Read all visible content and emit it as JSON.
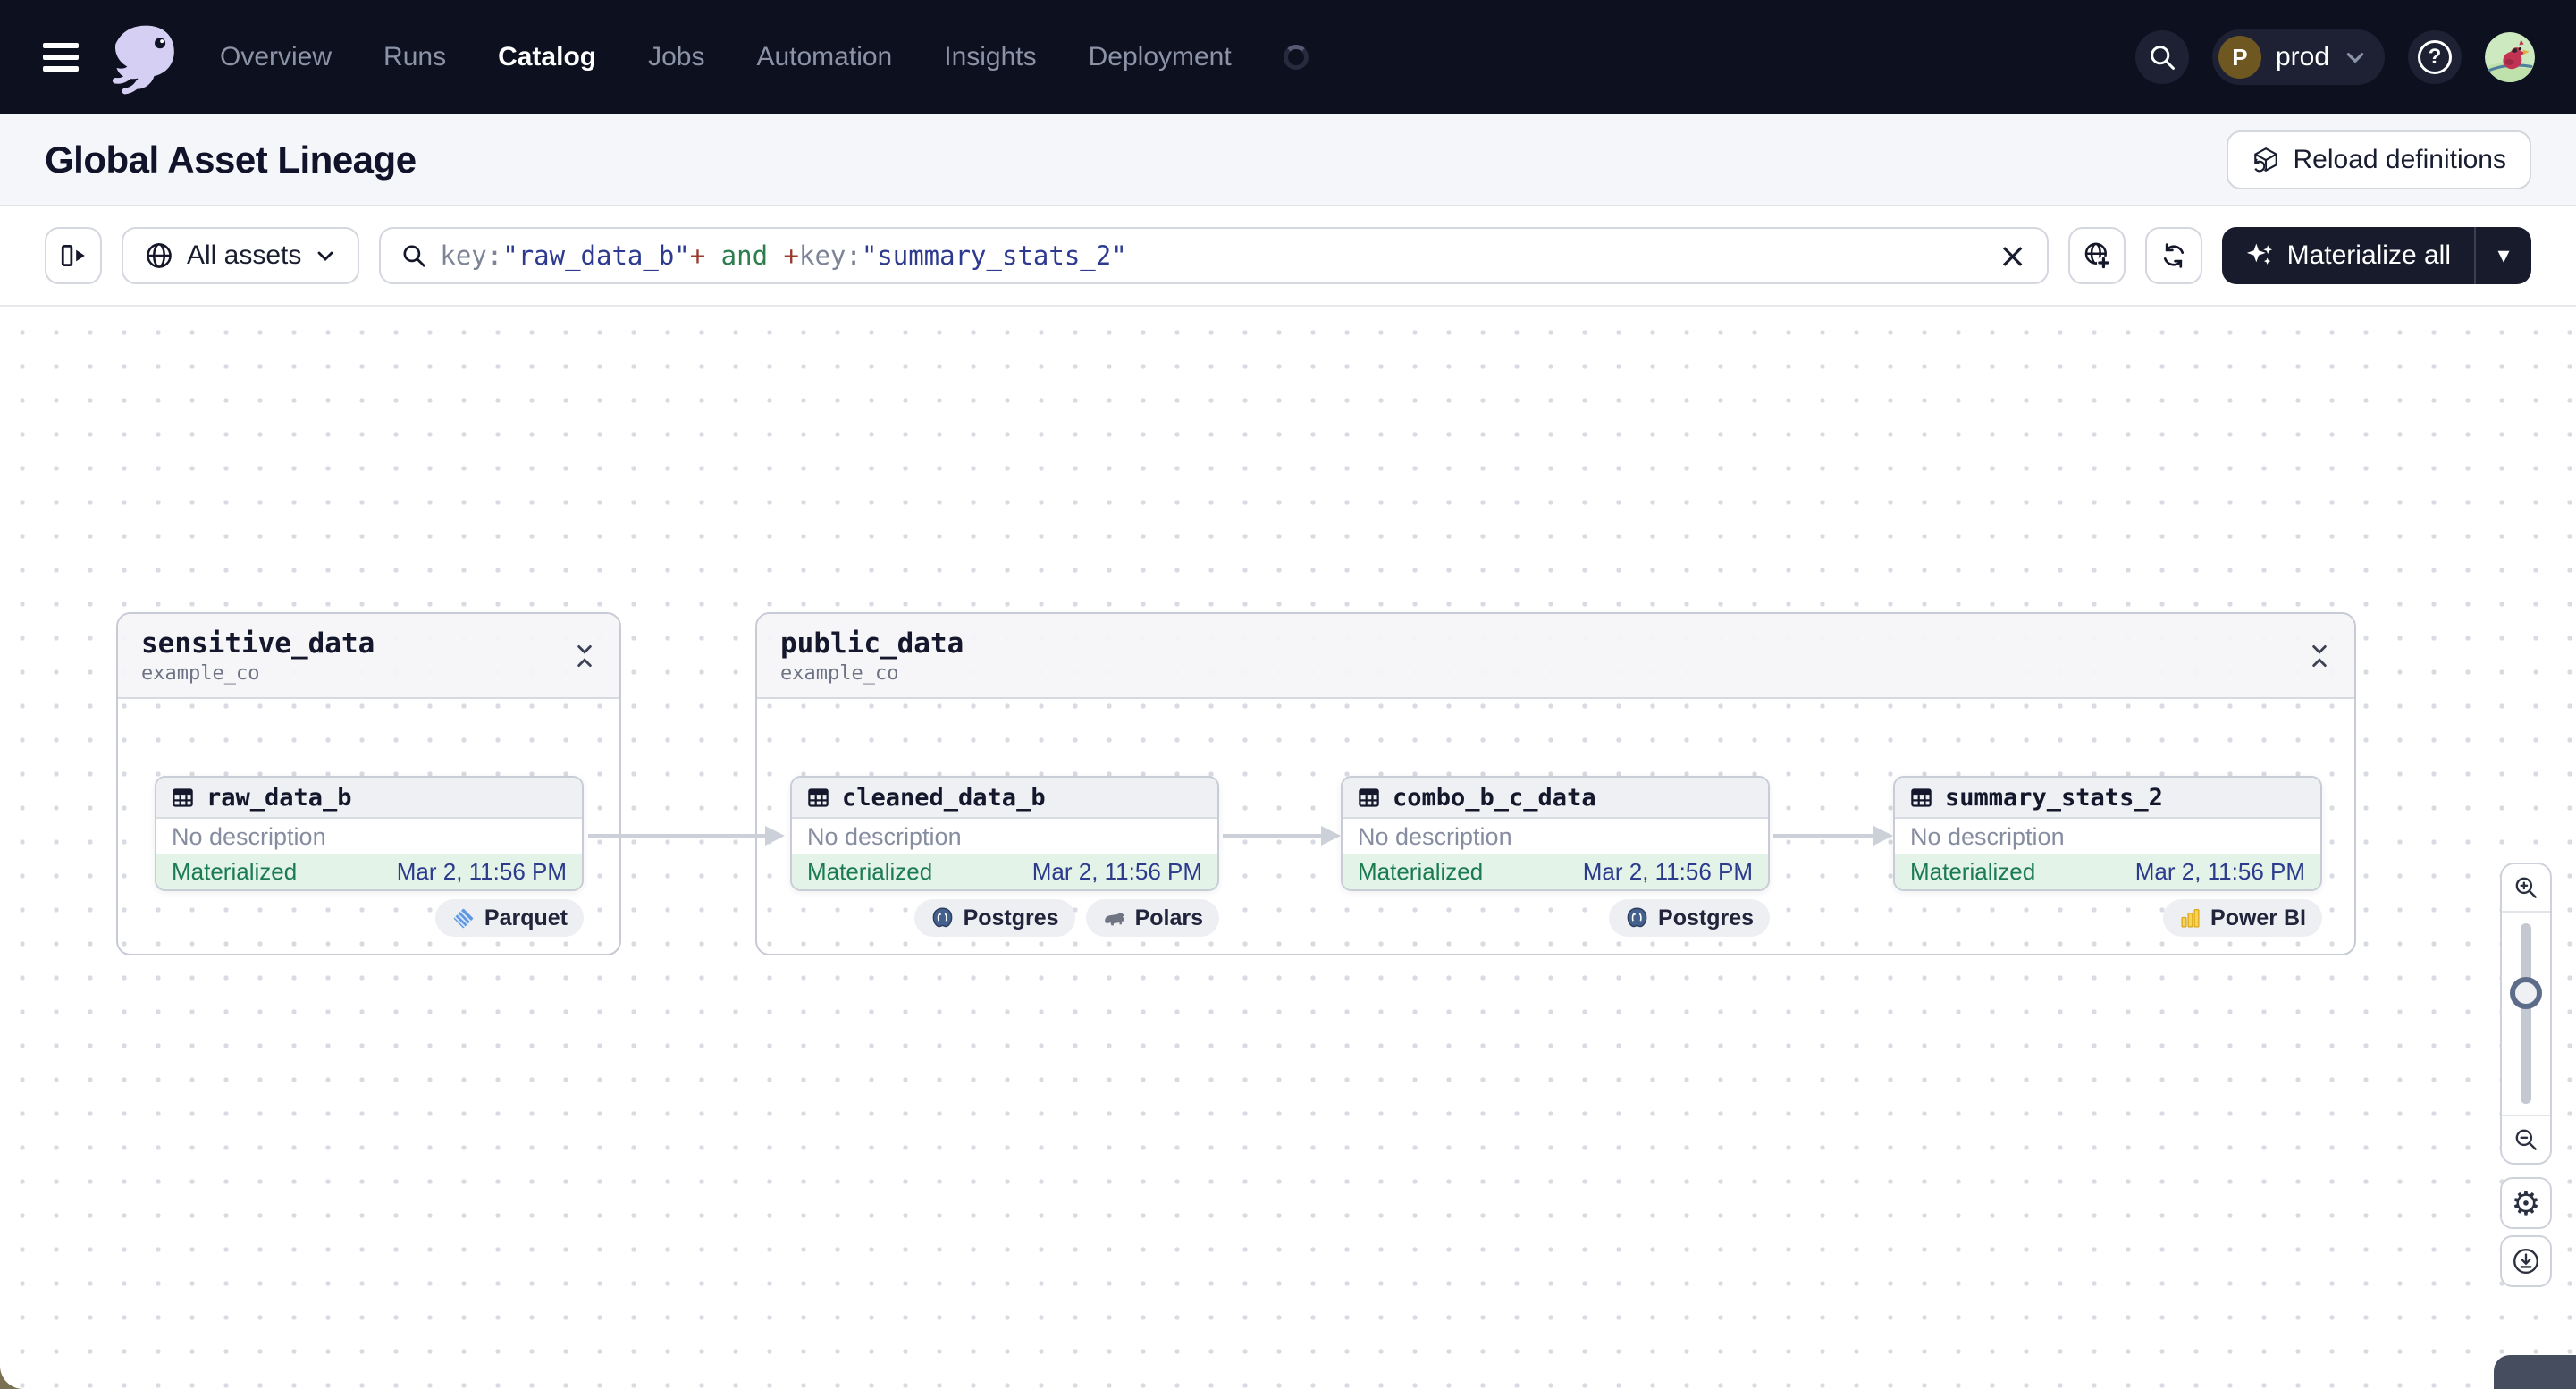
{
  "colors": {
    "nav_bg": "#0d101f",
    "materialize_bg": "#181b2c",
    "status_green_bg": "#e3f3e8",
    "status_green_text": "#1b7b50",
    "timestamp_blue": "#2c3b8c",
    "query_key": "#7d8497",
    "query_string": "#2e3a8f",
    "query_plus": "#993a2f",
    "query_and": "#2e7d4f",
    "edge_gray": "#ccd0d9"
  },
  "glyphs": {
    "clear": "×",
    "caret_down": "▾",
    "gear": "⚙",
    "help": "?"
  },
  "nav": {
    "menu": [
      "Overview",
      "Runs",
      "Catalog",
      "Jobs",
      "Automation",
      "Insights",
      "Deployment"
    ],
    "active_item": "Catalog",
    "deployment_switcher": {
      "initial": "P",
      "label": "prod"
    }
  },
  "page_header": {
    "title": "Global Asset Lineage",
    "reload_button_label": "Reload definitions"
  },
  "toolbar": {
    "asset_filter_label": "All assets",
    "materialize_button_label": "Materialize all",
    "search_query": {
      "seg_key1": "key:",
      "seg_val1": "\"raw_data_b\"",
      "seg_plus1": "+",
      "seg_and": " and ",
      "seg_plus2": "+",
      "seg_key2": "key:",
      "seg_val2": "\"summary_stats_2\""
    }
  },
  "graph": {
    "groups": [
      {
        "name": "sensitive_data",
        "location": "example_co",
        "assets": [
          {
            "name": "raw_data_b",
            "description": "No description",
            "status": "Materialized",
            "timestamp": "Mar 2, 11:56 PM",
            "badges": [
              {
                "label": "Parquet"
              }
            ]
          }
        ]
      },
      {
        "name": "public_data",
        "location": "example_co",
        "assets": [
          {
            "name": "cleaned_data_b",
            "description": "No description",
            "status": "Materialized",
            "timestamp": "Mar 2, 11:56 PM",
            "badges": [
              {
                "label": "Postgres"
              },
              {
                "label": "Polars"
              }
            ]
          },
          {
            "name": "combo_b_c_data",
            "description": "No description",
            "status": "Materialized",
            "timestamp": "Mar 2, 11:56 PM",
            "badges": [
              {
                "label": "Postgres"
              }
            ]
          },
          {
            "name": "summary_stats_2",
            "description": "No description",
            "status": "Materialized",
            "timestamp": "Mar 2, 11:56 PM",
            "badges": [
              {
                "label": "Power BI"
              }
            ]
          }
        ]
      }
    ]
  }
}
